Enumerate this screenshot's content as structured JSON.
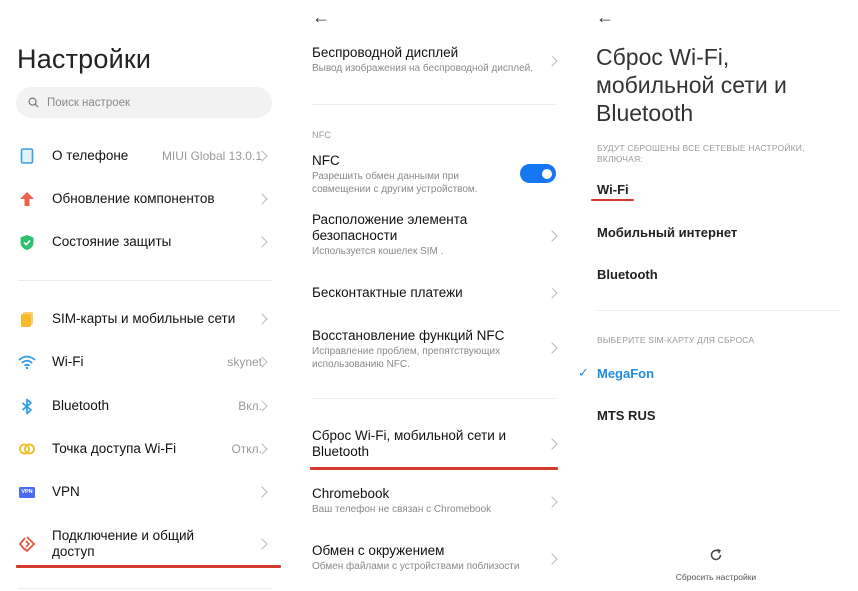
{
  "panel1": {
    "title": "Настройки",
    "search": {
      "placeholder": "Поиск настроек",
      "icon": "search-icon"
    },
    "groups": [
      [
        {
          "label": "О телефоне",
          "value": "MIUI Global 13.0.1",
          "icon": "phone-icon",
          "icon_color": "#3a9ee6"
        },
        {
          "label": "Обновление компонентов",
          "value": "",
          "icon": "update-arrow-icon",
          "icon_color": "#f0604a"
        },
        {
          "label": "Состояние защиты",
          "value": "",
          "icon": "shield-check-icon",
          "icon_color": "#2fbf71"
        }
      ],
      [
        {
          "label": "SIM-карты и мобильные сети",
          "value": "",
          "icon": "sim-card-icon",
          "icon_color": "#f5bb2a"
        },
        {
          "label": "Wi-Fi",
          "value": "skynet",
          "icon": "wifi-icon",
          "icon_color": "#2c9be8"
        },
        {
          "label": "Bluetooth",
          "value": "Вкл.",
          "icon": "bluetooth-icon",
          "icon_color": "#2c9be8"
        },
        {
          "label": "Точка доступа Wi-Fi",
          "value": "Откл.",
          "icon": "hotspot-icon",
          "icon_color": "#f0c030"
        },
        {
          "label": "VPN",
          "value": "",
          "icon": "vpn-icon",
          "icon_color": "#4a6cf0"
        },
        {
          "label": "Подключение и общий доступ",
          "value": "",
          "icon": "connection-sharing-icon",
          "icon_color": "#e8553e"
        }
      ]
    ],
    "vpn_badge": "VPN",
    "highlight_color": "#d33a2c"
  },
  "panel2": {
    "back_icon": "←",
    "items_top": [
      {
        "title": "Беспроводной дисплей",
        "subtitle": "Вывод изображения на беспроводной дисплей."
      }
    ],
    "nfc_section": "NFC",
    "nfc": {
      "title": "NFC",
      "subtitle": "Разрешить обмен данными при совмещении с другим устройством.",
      "enabled": true,
      "toggle_color": "#1677f0"
    },
    "items_nfc": [
      {
        "title": "Расположение элемента безопасности",
        "subtitle": "Используется кошелек SIM ."
      },
      {
        "title": "Бесконтактные платежи",
        "subtitle": ""
      },
      {
        "title": "Восстановление функций NFC",
        "subtitle": "Исправление проблем, препятствующих использованию NFC."
      }
    ],
    "items_bottom": [
      {
        "title": "Сброс Wi-Fi, мобильной сети и Bluetooth",
        "subtitle": ""
      },
      {
        "title": "Chromebook",
        "subtitle": "Ваш телефон не связан с Chromebook"
      },
      {
        "title": "Обмен с окружением",
        "subtitle": "Обмен файлами с устройствами поблизости"
      }
    ]
  },
  "panel3": {
    "back_icon": "←",
    "title": "Сброс Wi-Fi, мобильной сети и Bluetooth",
    "caption": "БУДУТ СБРОШЕНЫ ВСЕ СЕТЕВЫЕ НАСТРОЙКИ, ВКЛЮЧАЯ:",
    "includes": [
      "Wi-Fi",
      "Мобильный интернет",
      "Bluetooth"
    ],
    "sim_section": "ВЫБЕРИТЕ SIM-КАРТУ ДЛЯ СБРОСА",
    "sims": [
      {
        "name": "MegaFon",
        "selected": true
      },
      {
        "name": "MTS RUS",
        "selected": false
      }
    ],
    "check_icon": "✓",
    "accent_color": "#1f8ce6",
    "reset_label": "Сбросить настройки"
  }
}
